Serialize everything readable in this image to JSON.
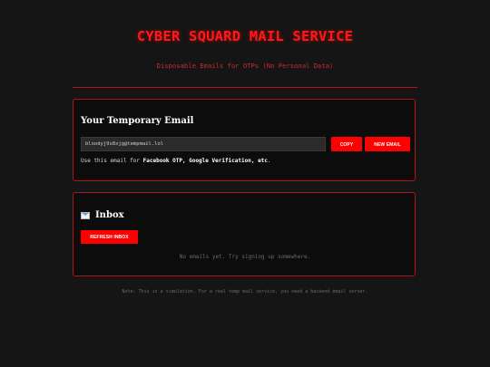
{
  "header": {
    "title": "CYBER SQUARD MAIL SERVICE",
    "subtitle": "Disposable Emails for OTPs (No Personal Data)"
  },
  "email_card": {
    "heading": "Your Temporary Email",
    "email_value": "bloodyj9s8xjg@tempmail.lol",
    "copy_label": "COPY",
    "new_label": "NEW EMAIL",
    "hint_prefix": "Use this email for ",
    "hint_services": "Facebook OTP, Google Verification, etc",
    "hint_suffix": "."
  },
  "inbox_card": {
    "icon": "envelope-icon",
    "heading": "Inbox",
    "refresh_label": "REFRESH INBOX",
    "empty_message": "No emails yet. Try signing up somewhere."
  },
  "footer": {
    "note": "Note: This is a simulation. For a real temp mail service, you need a backend email server."
  },
  "colors": {
    "accent": "#ff0000",
    "border": "#b11414",
    "background": "#151515",
    "card": "#0c0c0c"
  }
}
